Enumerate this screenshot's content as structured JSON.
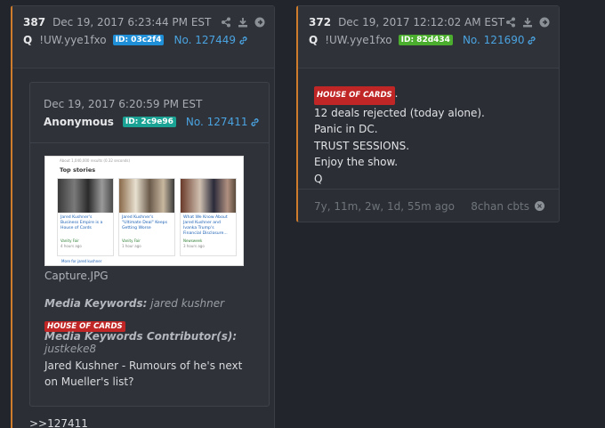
{
  "post_left": {
    "number": "387",
    "date": "Dec 19, 2017 6:23:44 PM EST",
    "author": "Q",
    "trip": "!UW.yye1fxo",
    "id": "ID: 03c2f4",
    "id_color": "#1f8fd8",
    "link": "No. 127449",
    "quoted": {
      "date": "Dec 19, 2017 6:20:59 PM EST",
      "author": "Anonymous",
      "id": "ID: 2c9e96",
      "id_color": "#1aa394",
      "link": "No. 127411",
      "image": {
        "source": "About 1,040,000 results (0.32 seconds)",
        "section": "Top stories",
        "cards": [
          {
            "headline": "Jared Kushner's Business Empire is a House of Cards",
            "source": "Vanity Fair",
            "time": "4 hours ago"
          },
          {
            "headline": "Jared Kushner's \"Ultimate Deal\" Keeps Getting Worse",
            "source": "Vanity Fair",
            "time": "1 hour ago"
          },
          {
            "headline": "What We Know About Jared Kushner and Ivanka Trump's Financial Disclosure...",
            "source": "Newsweek",
            "time": "3 hours ago"
          }
        ],
        "more": "More for jared kushner"
      },
      "filename": "Capture.JPG",
      "media_keywords_label": "Media Keywords:",
      "media_keywords": "jared kushner",
      "badge": "HOUSE OF CARDS",
      "contributor_label": "Media Keywords Contributor(s):",
      "contributor": "justkeke8",
      "body": "Jared Kushner - Rumours of he's next on Mueller's list?"
    },
    "reply_ref": ">>127411"
  },
  "post_right": {
    "number": "372",
    "date": "Dec 19, 2017 12:12:02 AM EST",
    "author": "Q",
    "trip": "!UW.yye1fxo",
    "id": "ID: 82d434",
    "id_color": "#4cae2e",
    "link": "No. 121690",
    "badge": "HOUSE OF CARDS",
    "badge_suffix": ".",
    "lines": [
      "12 deals rejected (today alone).",
      "Panic in DC.",
      "TRUST SESSIONS.",
      "Enjoy the show.",
      "Q"
    ],
    "age": "7y, 11m, 2w, 1d, 55m ago",
    "source": "8chan cbts"
  },
  "colors": {
    "accent": "#cf7d2d",
    "link": "#4aa3e0",
    "badge": "#c02626"
  }
}
